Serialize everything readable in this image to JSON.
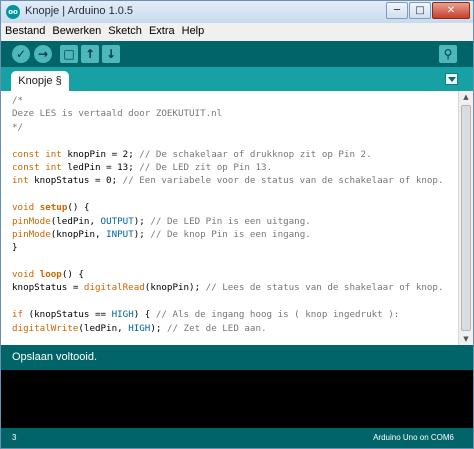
{
  "window": {
    "title": "Knopje | Arduino 1.0.5",
    "app_icon_text": "oo",
    "minimize_glyph": "─",
    "maximize_glyph": "□",
    "close_glyph": "✕"
  },
  "menu": [
    "Bestand",
    "Bewerken",
    "Sketch",
    "Extra",
    "Help"
  ],
  "toolbar": {
    "verify_glyph": "✓",
    "upload_glyph": "→",
    "new_glyph": "□",
    "open_glyph": "↑",
    "save_glyph": "↓",
    "serial_monitor_glyph": "⚲"
  },
  "tabs": [
    {
      "label": "Knopje §"
    }
  ],
  "code_lines": [
    [
      {
        "t": "/*",
        "c": "comment"
      }
    ],
    [
      {
        "t": "Deze LES is vertaald door ZOEKUTUIT.nl",
        "c": "comment"
      }
    ],
    [
      {
        "t": "*/",
        "c": "comment"
      }
    ],
    [],
    [
      {
        "t": "const",
        "c": "type"
      },
      {
        "t": " "
      },
      {
        "t": "int",
        "c": "type"
      },
      {
        "t": " knopPin = 2; "
      },
      {
        "t": "// De schakelaar of drukknop zit op Pin 2.",
        "c": "comment"
      }
    ],
    [
      {
        "t": "const",
        "c": "type"
      },
      {
        "t": " "
      },
      {
        "t": "int",
        "c": "type"
      },
      {
        "t": " ledPin = 13; "
      },
      {
        "t": "// De LED zit op Pin 13.",
        "c": "comment"
      }
    ],
    [
      {
        "t": "int",
        "c": "type"
      },
      {
        "t": " knopStatus = 0; "
      },
      {
        "t": "// Een variabele voor de status van de schakelaar of knop.",
        "c": "comment"
      }
    ],
    [],
    [
      {
        "t": "void",
        "c": "type"
      },
      {
        "t": " "
      },
      {
        "t": "setup",
        "c": "func"
      },
      {
        "t": "() {"
      }
    ],
    [
      {
        "t": "pinMode",
        "c": "kw"
      },
      {
        "t": "(ledPin, "
      },
      {
        "t": "OUTPUT",
        "c": "const"
      },
      {
        "t": "); "
      },
      {
        "t": "// De LED Pin is een uitgang.",
        "c": "comment"
      }
    ],
    [
      {
        "t": "pinMode",
        "c": "kw"
      },
      {
        "t": "(knopPin, "
      },
      {
        "t": "INPUT",
        "c": "const"
      },
      {
        "t": "); "
      },
      {
        "t": "// De knop Pin is een ingang.",
        "c": "comment"
      }
    ],
    [
      {
        "t": "}"
      }
    ],
    [],
    [
      {
        "t": "void",
        "c": "type"
      },
      {
        "t": " "
      },
      {
        "t": "loop",
        "c": "func"
      },
      {
        "t": "() {"
      }
    ],
    [
      {
        "t": "knopStatus = "
      },
      {
        "t": "digitalRead",
        "c": "kw"
      },
      {
        "t": "(knopPin); "
      },
      {
        "t": "// Lees de status van de shakelaar of knop.",
        "c": "comment"
      }
    ],
    [],
    [
      {
        "t": "if",
        "c": "kw"
      },
      {
        "t": " (knopStatus == "
      },
      {
        "t": "HIGH",
        "c": "const"
      },
      {
        "t": ") { "
      },
      {
        "t": "// Als de ingang hoog is ( knop ingedrukt ):",
        "c": "comment"
      }
    ],
    [
      {
        "t": "digitalWrite",
        "c": "kw"
      },
      {
        "t": "(ledPin, "
      },
      {
        "t": "HIGH",
        "c": "const"
      },
      {
        "t": "); "
      },
      {
        "t": "// Zet de LED aan.",
        "c": "comment"
      }
    ]
  ],
  "status": {
    "message": "Opslaan voltooid."
  },
  "footer": {
    "line_number": "3",
    "board": "Arduino Uno on COM6"
  },
  "colors": {
    "toolbar_bg": "#006468",
    "tab_bar_bg": "#17a1a5",
    "console_bg": "#000000",
    "keyword": "#cc6600",
    "constant": "#006699",
    "comment": "#777777"
  }
}
